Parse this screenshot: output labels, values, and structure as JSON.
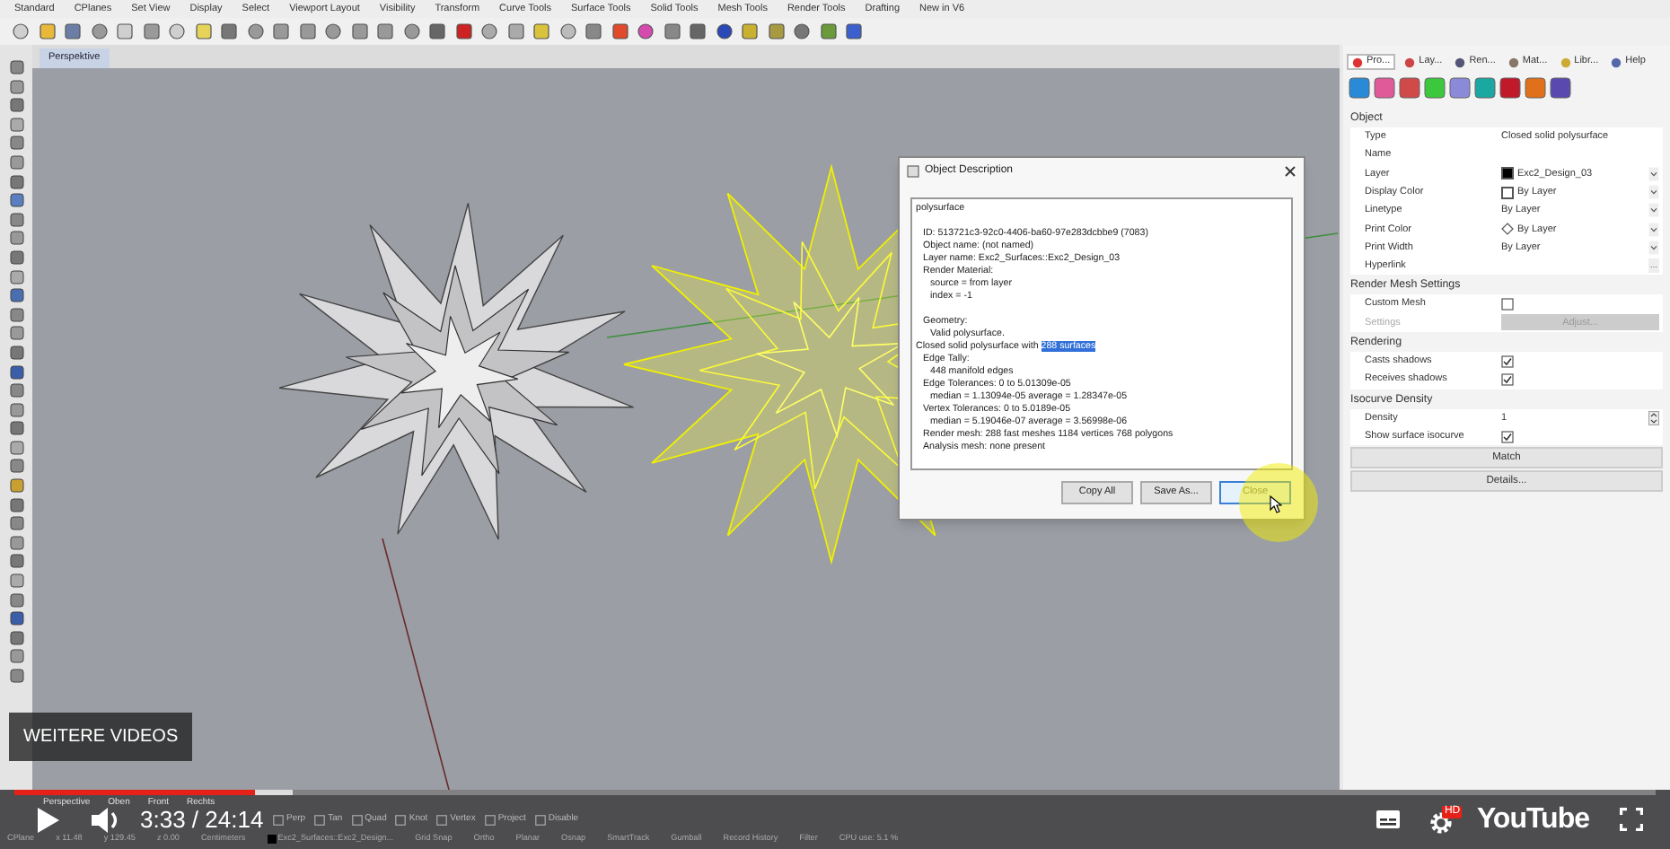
{
  "menu_tabs": [
    "Standard",
    "CPlanes",
    "Set View",
    "Display",
    "Select",
    "Viewport Layout",
    "Visibility",
    "Transform",
    "Curve Tools",
    "Surface Tools",
    "Solid Tools",
    "Mesh Tools",
    "Render Tools",
    "Drafting",
    "New in V6"
  ],
  "viewport": {
    "title": "Perspektive"
  },
  "dialog": {
    "title": "Object Description",
    "lines": [
      {
        "text": "polysurface"
      },
      {
        "text": "ID: 513721c3-92c0-4406-ba60-97e283dcbbe9 (7083)",
        "spaced": true,
        "indented": true
      },
      {
        "text": "Object name: (not named)",
        "indented": true
      },
      {
        "text": "Layer name: Exc2_Surfaces::Exc2_Design_03",
        "indented": true
      },
      {
        "text": "Render Material:",
        "indented": true,
        "children": [
          {
            "text": "source = from layer"
          },
          {
            "text": "index = -1"
          }
        ]
      },
      {
        "text": "Geometry:",
        "spaced": true,
        "indented": true,
        "children": [
          {
            "text": "Valid polysurface."
          }
        ]
      },
      {
        "text": "Closed solid polysurface with ",
        "selected_text": "288 surfaces"
      },
      {
        "text": "Edge Tally:",
        "indented": true,
        "children": [
          {
            "text": "448 manifold edges"
          }
        ]
      },
      {
        "text": "Edge Tolerances: 0 to 5.01309e-05",
        "indented": true,
        "children": [
          {
            "text": "median = 1.13094e-05 average = 1.28347e-05"
          }
        ]
      },
      {
        "text": "Vertex Tolerances: 0 to 5.0189e-05",
        "indented": true,
        "children": [
          {
            "text": "median = 5.19046e-07 average = 3.56998e-06"
          }
        ]
      },
      {
        "text": "Render mesh: 288 fast meshes  1184 vertices  768 polygons",
        "indented": true
      },
      {
        "text": "Analysis mesh: none present",
        "indented": true
      }
    ],
    "buttons": [
      {
        "label": "Copy All",
        "focused": false
      },
      {
        "label": "Save As...",
        "focused": false
      },
      {
        "label": "Close",
        "focused": true
      }
    ]
  },
  "panel": {
    "tabs": [
      {
        "label": "Pro...",
        "selected": true
      },
      {
        "label": "Lay...",
        "selected": false
      },
      {
        "label": "Ren...",
        "selected": false
      },
      {
        "label": "Mat...",
        "selected": false
      },
      {
        "label": "Libr...",
        "selected": false
      },
      {
        "label": "Help",
        "selected": false
      }
    ],
    "sections": [
      {
        "title": "Object",
        "rows": [
          {
            "label": "Type",
            "kind": "text",
            "value": "Closed solid polysurface"
          },
          {
            "label": "Name",
            "kind": "text"
          },
          {
            "label": "Layer",
            "kind": "swatch",
            "value": "Exc2_Design_03",
            "color": "#000000",
            "dropdown": true
          },
          {
            "label": "Display Color",
            "kind": "swatch",
            "value": "By Layer",
            "color": "#ffffff",
            "dropdown": true
          },
          {
            "label": "Linetype",
            "kind": "text",
            "value": "By Layer",
            "dropdown": true
          },
          {
            "label": "Print Color",
            "kind": "icon",
            "value": "By Layer",
            "dropdown": true
          },
          {
            "label": "Print Width",
            "kind": "text",
            "value": "By Layer",
            "dropdown": true
          },
          {
            "label": "Hyperlink",
            "kind": "text",
            "action": "..."
          }
        ]
      },
      {
        "title": "Render Mesh Settings",
        "rows": [
          {
            "label": "Custom Mesh",
            "kind": "checkbox",
            "checked": false
          },
          {
            "label": "Settings",
            "kind": "button",
            "value": "Adjust...",
            "disabled": true
          }
        ]
      },
      {
        "title": "Rendering",
        "rows": [
          {
            "label": "Casts shadows",
            "kind": "checkbox",
            "checked": true
          },
          {
            "label": "Receives shadows",
            "kind": "checkbox",
            "checked": true
          }
        ]
      },
      {
        "title": "Isocurve Density",
        "rows": [
          {
            "label": "Density",
            "kind": "spinner",
            "value": "1"
          },
          {
            "label": "Show surface isocurve",
            "kind": "checkbox",
            "checked": true
          }
        ]
      }
    ],
    "buttons": [
      "Match",
      "Details..."
    ]
  },
  "viewport_tabs": [
    "Perspective",
    "Oben",
    "Front",
    "Rechts"
  ],
  "osnaps": [
    {
      "label": "Perp",
      "checked": false
    },
    {
      "label": "Tan",
      "checked": false
    },
    {
      "label": "Quad",
      "checked": false
    },
    {
      "label": "Knot",
      "checked": false
    },
    {
      "label": "Vertex",
      "checked": false
    },
    {
      "label": "Project",
      "checked": false
    },
    {
      "label": "Disable",
      "checked": false
    }
  ],
  "status_bar": [
    {
      "kind": "text",
      "text": "CPlane"
    },
    {
      "kind": "text",
      "text": "x 11.48"
    },
    {
      "kind": "text",
      "text": "y 129.45"
    },
    {
      "kind": "text",
      "text": "z 0.00"
    },
    {
      "kind": "text",
      "text": "Centimeters"
    },
    {
      "kind": "layer",
      "text": "Exc2_Surfaces::Exc2_Design..."
    },
    {
      "kind": "text",
      "text": "Grid Snap"
    },
    {
      "kind": "text",
      "text": "Ortho"
    },
    {
      "kind": "text",
      "text": "Planar"
    },
    {
      "kind": "text",
      "text": "Osnap"
    },
    {
      "kind": "text",
      "text": "SmartTrack"
    },
    {
      "kind": "text",
      "text": "Gumball"
    },
    {
      "kind": "text",
      "text": "Record History"
    },
    {
      "kind": "text",
      "text": "Filter"
    },
    {
      "kind": "text",
      "text": "CPU use: 5.1 %"
    }
  ],
  "video": {
    "more_videos": "WEITERE VIDEOS",
    "time": "3:33 / 24:14",
    "progress": {
      "level": 0.147
    },
    "buffered": {
      "level": 0.17
    },
    "hd_badge": "HD",
    "logo": "YouTube"
  }
}
